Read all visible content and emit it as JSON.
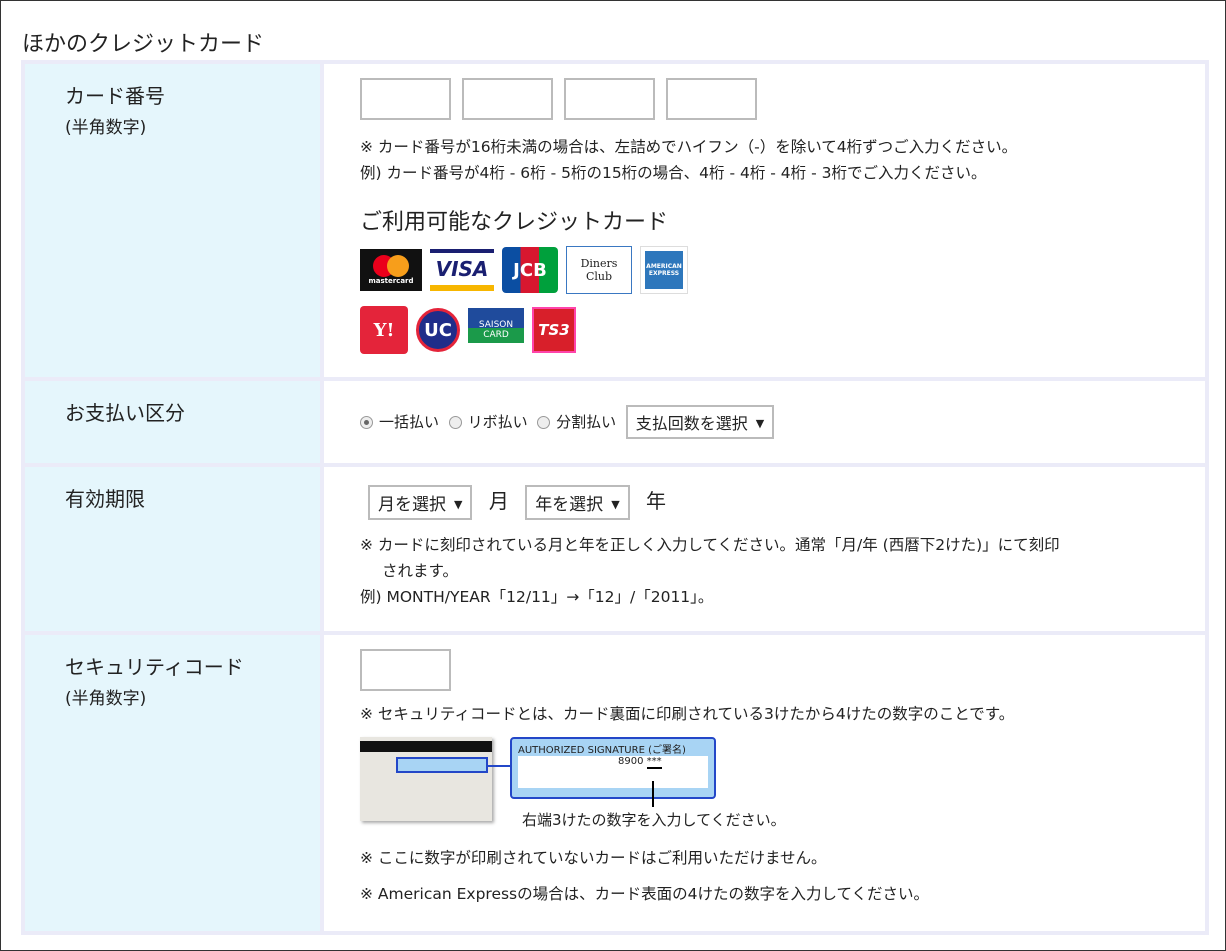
{
  "title": "ほかのクレジットカード",
  "card_number": {
    "label": "カード番号",
    "sub": "(半角数字)",
    "note1": "※ カード番号が16桁未満の場合は、左詰めでハイフン（-）を除いて4桁ずつご入力ください。",
    "note2": "例) カード番号が4桁 - 6桁 - 5桁の15桁の場合、4桁 - 4桁 - 4桁 - 3桁でご入力ください。",
    "cards_heading": "ご利用可能なクレジットカード",
    "cards": [
      {
        "name": "mastercard",
        "text": "mastercard"
      },
      {
        "name": "VISA",
        "text": "VISA"
      },
      {
        "name": "JCB",
        "text": "JCB"
      },
      {
        "name": "Diners Club",
        "text": "Diners Club"
      },
      {
        "name": "American Express",
        "text": "AMERICAN EXPRESS"
      },
      {
        "name": "Yahoo",
        "text": "Y!"
      },
      {
        "name": "UC",
        "text": "UC"
      },
      {
        "name": "SAISON CARD",
        "text": "SAISON CARD"
      },
      {
        "name": "TS3",
        "text": "TS3"
      }
    ]
  },
  "payment": {
    "label": "お支払い区分",
    "options": [
      "一括払い",
      "リボ払い",
      "分割払い"
    ],
    "selected": 0,
    "installments": "支払回数を選択"
  },
  "expiry": {
    "label": "有効期限",
    "month_select": "月を選択",
    "month_unit": "月",
    "year_select": "年を選択",
    "year_unit": "年",
    "note1": "※ カードに刻印されている月と年を正しく入力してください。通常「月/年 (西暦下2けた)」にて刻印",
    "note1b": "されます。",
    "note2": "例) MONTH/YEAR「12/11」→「12」/「2011」。"
  },
  "security": {
    "label": "セキュリティコード",
    "sub": "(半角数字)",
    "note1": "※ セキュリティコードとは、カード裏面に印刷されている3けたから4けたの数字のことです。",
    "sig_label": "AUTHORIZED SIGNATURE (ご署名)",
    "sig_number": "8900",
    "sig_mask": "***",
    "caption": "右端3けたの数字を入力してください。",
    "note2": "※ ここに数字が印刷されていないカードはご利用いただけません。",
    "note3": "※ American Expressの場合は、カード表面の4けたの数字を入力してください。"
  }
}
